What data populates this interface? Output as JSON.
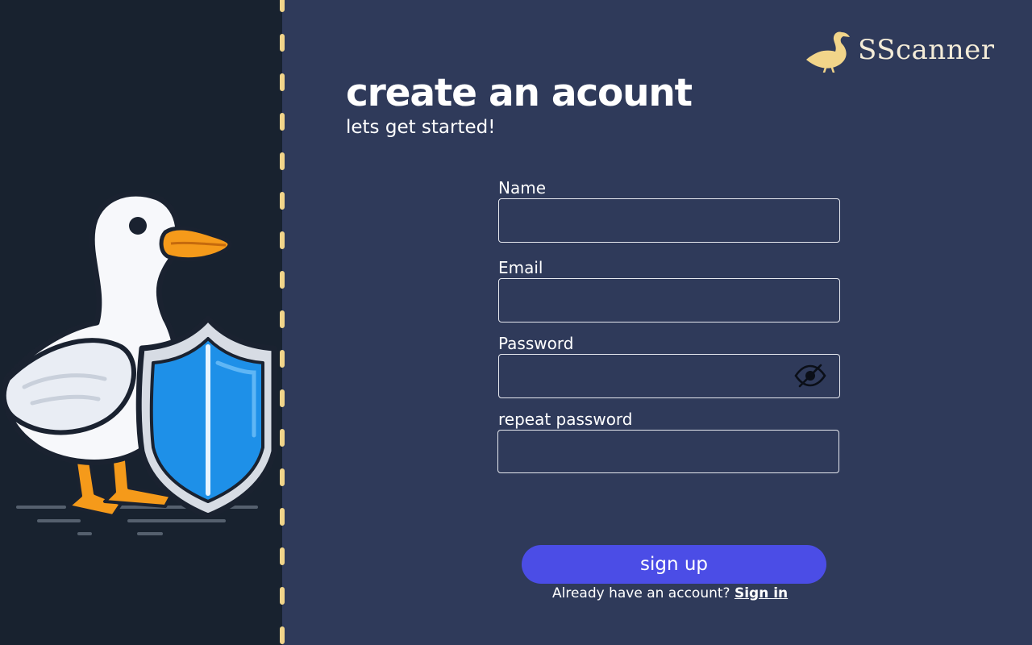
{
  "brand": {
    "name": "SScanner"
  },
  "header": {
    "title": "create an acount",
    "subtitle": "lets get started!"
  },
  "form": {
    "name": {
      "label": "Name",
      "value": "",
      "placeholder": ""
    },
    "email": {
      "label": "Email",
      "value": "",
      "placeholder": ""
    },
    "password": {
      "label": "Password",
      "value": "",
      "placeholder": "",
      "visibility_icon": "eye-slash-icon"
    },
    "repeat_password": {
      "label": "repeat password",
      "value": "",
      "placeholder": ""
    },
    "submit_label": "sign up"
  },
  "footer": {
    "prompt": "Already have an account?",
    "signin_link": "Sign in"
  },
  "colors": {
    "background": "#2f3a5a",
    "left_panel": "#18222f",
    "accent_button": "#4b4de6",
    "divider_dashes": "#f2d58a",
    "brand_text": "#f4ecd8"
  }
}
